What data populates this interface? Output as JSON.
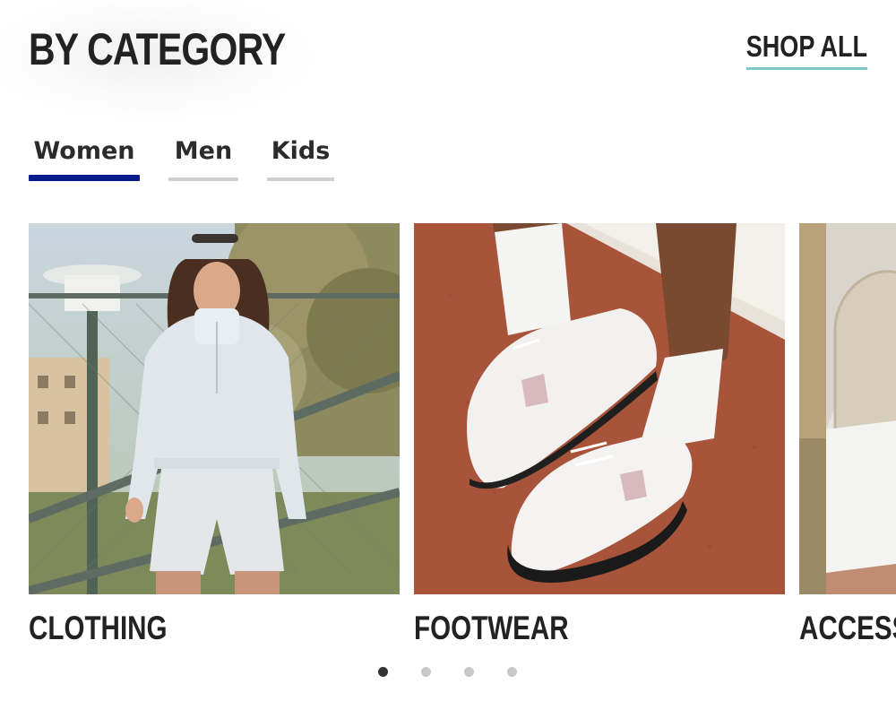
{
  "section": {
    "heading": "BY CATEGORY",
    "shop_all": "SHOP ALL",
    "accent_color": "#7cc8c4"
  },
  "tabs": [
    {
      "label": "Women",
      "active": true
    },
    {
      "label": "Men",
      "active": false
    },
    {
      "label": "Kids",
      "active": false
    }
  ],
  "active_tab_color": "#0a1a8c",
  "categories": [
    {
      "label": "CLOTHING",
      "image": "woman-in-light-blue-sweatshirt-photo"
    },
    {
      "label": "FOOTWEAR",
      "image": "white-sneakers-on-track-photo"
    },
    {
      "label": "ACCESSO",
      "image": "beige-bag-photo"
    }
  ],
  "pagination": {
    "pages": 4,
    "current": 1
  }
}
